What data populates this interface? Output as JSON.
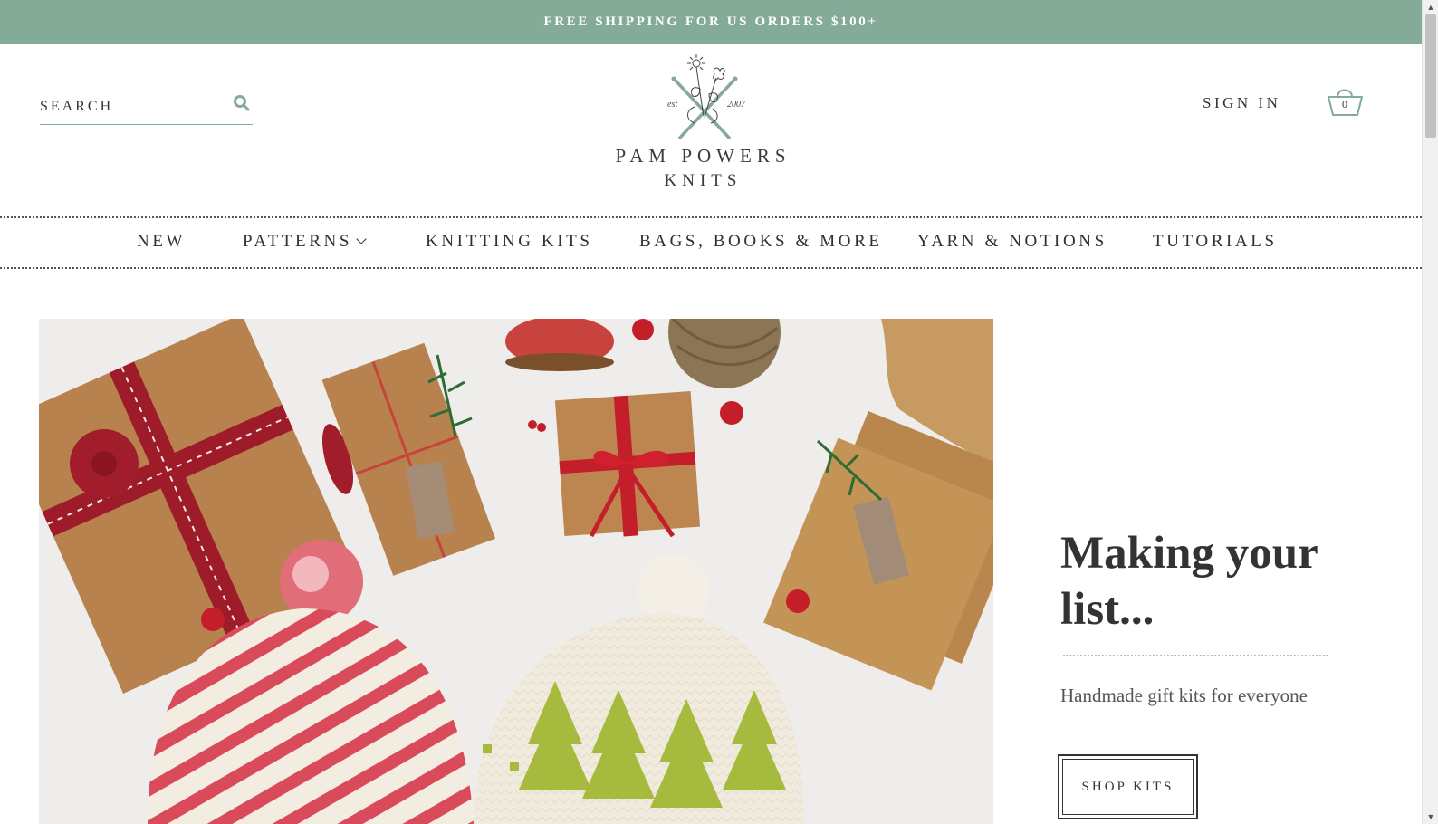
{
  "announcement": {
    "text": "FREE SHIPPING FOR US ORDERS $100+"
  },
  "header": {
    "search_placeholder": "SEARCH",
    "logo": {
      "name": "PAM POWERS",
      "sub": "KNITS",
      "est_left": "est",
      "est_right": "2007"
    },
    "sign_in": "SIGN IN",
    "cart_count": "0"
  },
  "nav": {
    "items": [
      {
        "label": "NEW"
      },
      {
        "label": "PATTERNS"
      },
      {
        "label": "KNITTING KITS"
      },
      {
        "label": "BAGS, BOOKS & MORE"
      },
      {
        "label": "YARN & NOTIONS"
      },
      {
        "label": "TUTORIALS"
      }
    ]
  },
  "hero": {
    "title": "Making your list...",
    "subtitle": "Handmade gift kits for everyone",
    "button": "SHOP KITS"
  },
  "colors": {
    "accent": "#84aa98",
    "text": "#2f2f2f"
  }
}
